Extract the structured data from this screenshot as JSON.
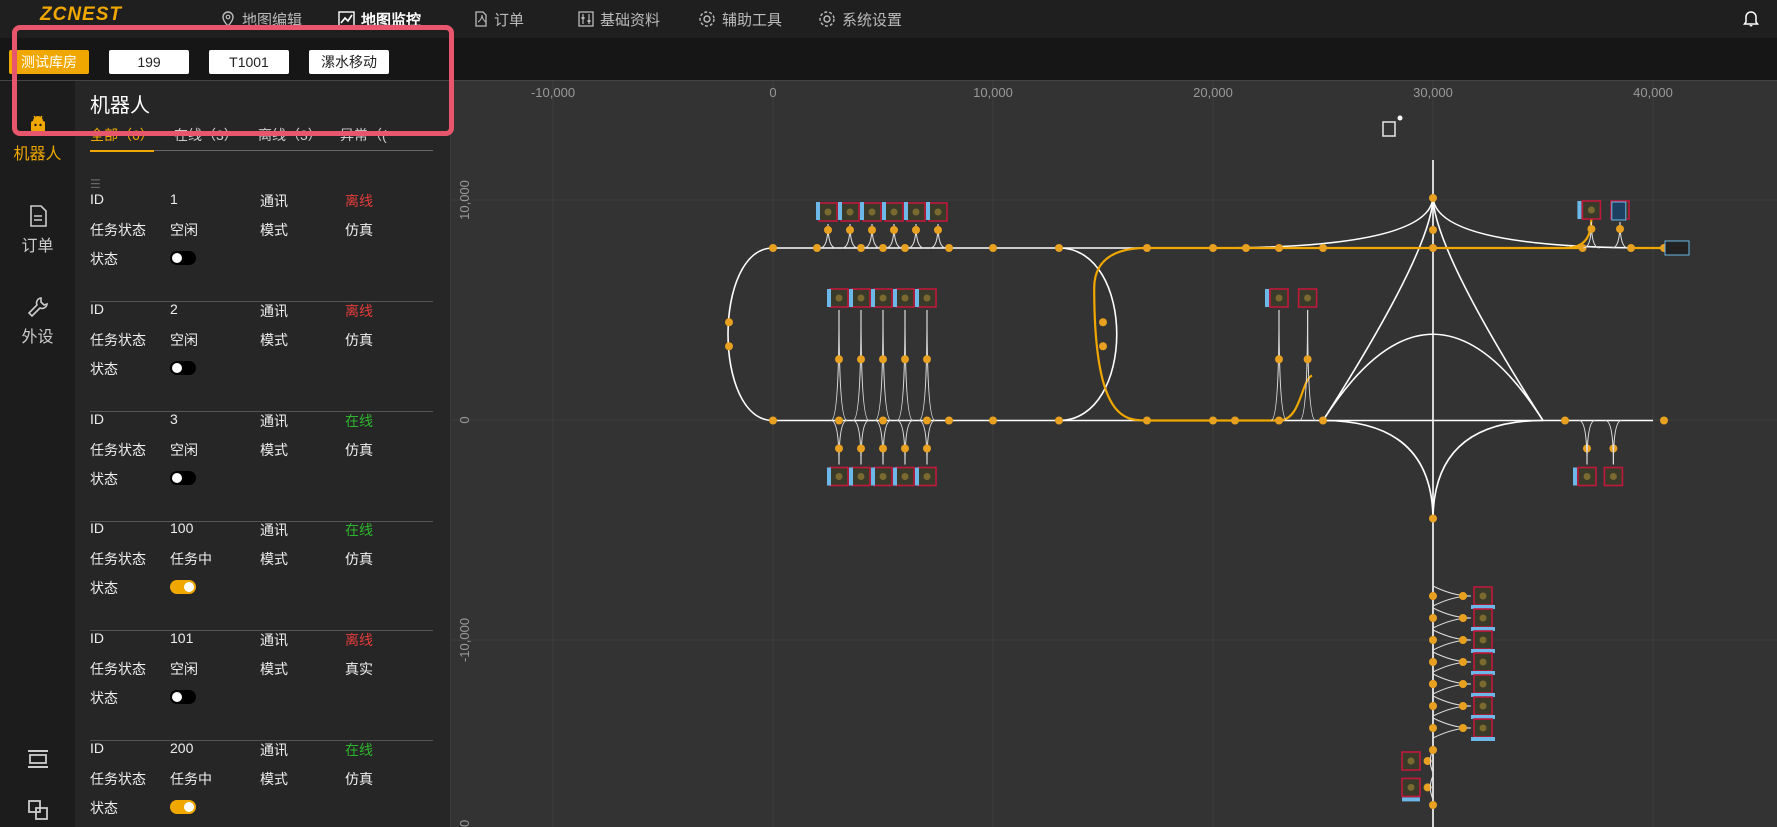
{
  "app": {
    "logo": "ZCNEST"
  },
  "nav": {
    "items": [
      {
        "label": "地图编辑",
        "icon": "map-pin-icon"
      },
      {
        "label": "地图监控",
        "icon": "chart-line-icon",
        "active": true
      },
      {
        "label": "订单",
        "icon": "document-pdf-icon"
      },
      {
        "label": "基础资料",
        "icon": "sliders-icon"
      },
      {
        "label": "辅助工具",
        "icon": "gear-icon"
      },
      {
        "label": "系统设置",
        "icon": "gear-icon"
      }
    ],
    "bell_icon": "bell-icon"
  },
  "subbar": {
    "warehouse": "测试库房",
    "field1": "199",
    "field2": "T1001",
    "field3": "漯水移动"
  },
  "rail": {
    "items": [
      {
        "label": "机器人",
        "icon": "robot-icon"
      },
      {
        "label": "订单",
        "icon": "document-icon"
      },
      {
        "label": "外设",
        "icon": "wrench-icon"
      }
    ],
    "bottom_icons": [
      "layout-icon",
      "layers-icon"
    ]
  },
  "panel": {
    "title": "机器人",
    "tabs": [
      "全部（6）",
      "在线（3）",
      "离线（3）",
      "异常（("
    ],
    "labels": {
      "id": "ID",
      "comm": "通讯",
      "task_state": "任务状态",
      "mode": "模式",
      "state": "状态"
    },
    "robots": [
      {
        "id": "1",
        "comm": "离线",
        "task": "空闲",
        "mode": "仿真",
        "enabled": false
      },
      {
        "id": "2",
        "comm": "离线",
        "task": "空闲",
        "mode": "仿真",
        "enabled": false
      },
      {
        "id": "3",
        "comm": "在线",
        "task": "空闲",
        "mode": "仿真",
        "enabled": false
      },
      {
        "id": "100",
        "comm": "在线",
        "task": "任务中",
        "mode": "仿真",
        "enabled": true
      },
      {
        "id": "101",
        "comm": "离线",
        "task": "空闲",
        "mode": "真实",
        "enabled": false
      },
      {
        "id": "200",
        "comm": "在线",
        "task": "任务中",
        "mode": "仿真",
        "enabled": true
      }
    ]
  },
  "map": {
    "x_ticks": [
      "-10,000",
      "0",
      "10,000",
      "20,000",
      "30,000",
      "40,000"
    ],
    "y_ticks": [
      "10,000",
      "0",
      "-10,000",
      "00"
    ],
    "charger_icon": "charger-icon",
    "colors": {
      "path": "#ffffff",
      "active_path": "#f0a800",
      "node": "#e8a020",
      "slot_border": "#c0183c",
      "slot_tag": "#6cb8e8"
    }
  }
}
